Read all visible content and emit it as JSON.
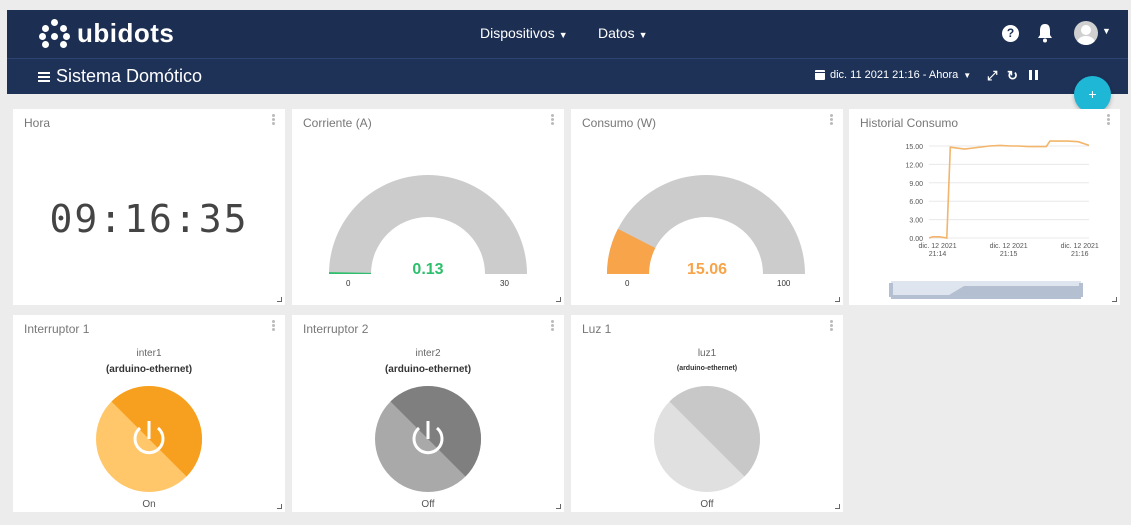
{
  "brand": {
    "name": "ubidots"
  },
  "topnav": {
    "devices": "Dispositivos",
    "data": "Datos",
    "help": "?"
  },
  "dashboard": {
    "title": "Sistema Domótico",
    "date_range": "dic. 11 2021 21:16 - Ahora",
    "add": "+"
  },
  "widgets": {
    "clock": {
      "title": "Hora",
      "time": "09:16:35"
    },
    "current": {
      "title": "Corriente (A)",
      "value": "0.13",
      "min": "0",
      "max": "30",
      "fraction": 0.0043,
      "color": "#2ebf6c"
    },
    "power": {
      "title": "Consumo (W)",
      "value": "15.06",
      "min": "0",
      "max": "100",
      "fraction": 0.1506,
      "color": "#f7a44a"
    },
    "history": {
      "title": "Historial Consumo"
    },
    "switch1": {
      "title": "Interruptor 1",
      "variable": "inter1",
      "device": "(arduino-ethernet)",
      "state": "On",
      "color_light": "#ffc76a",
      "color_dark": "#f7a020"
    },
    "switch2": {
      "title": "Interruptor 2",
      "variable": "inter2",
      "device": "(arduino-ethernet)",
      "state": "Off",
      "color_light": "#a9a9a9",
      "color_dark": "#7f7f7f"
    },
    "light1": {
      "title": "Luz 1",
      "variable": "luz1",
      "device": "(arduino-ethernet)",
      "state": "Off",
      "color_light": "#e0e0e0",
      "color_dark": "#c8c8c8"
    }
  },
  "chart_data": {
    "type": "line",
    "title": "",
    "xlabel": "",
    "ylabel": "",
    "ylim": [
      0,
      15
    ],
    "y_ticks": [
      "0.00",
      "3.00",
      "6.00",
      "9.00",
      "12.00",
      "15.00"
    ],
    "x_ticks": [
      {
        "line1": "dic. 12 2021",
        "line2": "21:14"
      },
      {
        "line1": "dic. 12 2021",
        "line2": "21:15"
      },
      {
        "line1": "dic. 12 2021",
        "line2": "21:16"
      }
    ],
    "x": [
      0,
      0.05,
      0.15,
      0.25,
      0.3,
      0.5,
      0.85,
      1.0,
      1.15,
      1.25,
      1.4,
      1.65,
      1.7,
      1.8,
      1.95,
      2.1,
      2.25
    ],
    "series": [
      {
        "color": "#f2b56b",
        "values": [
          0,
          0.2,
          0.2,
          0,
          14.8,
          14.5,
          15.0,
          15.1,
          15.0,
          15.0,
          14.9,
          14.9,
          15.8,
          15.8,
          15.8,
          15.7,
          15.1
        ]
      }
    ],
    "grid": true
  }
}
